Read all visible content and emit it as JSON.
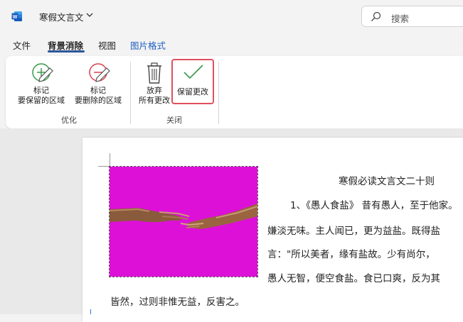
{
  "titlebar": {
    "doc_title": "寒假文言文",
    "search_placeholder": "搜索",
    "accent": "#2b579a"
  },
  "tabs": [
    {
      "label": "文件"
    },
    {
      "label": "背景消除",
      "active": true
    },
    {
      "label": "视图"
    },
    {
      "label": "图片格式"
    }
  ],
  "ribbon": {
    "mark_keep": {
      "line1": "标记",
      "line2": "要保留的区域",
      "icon": "plus-pencil-icon"
    },
    "mark_remove": {
      "line1": "标记",
      "line2": "要删除的区域",
      "icon": "minus-pencil-icon"
    },
    "group_refine": "优化",
    "discard": {
      "line1": "放弃",
      "line2": "所有更改",
      "icon": "trash-icon"
    },
    "keep_changes": {
      "label": "保留更改",
      "icon": "checkmark-icon"
    },
    "group_close": "关闭"
  },
  "document": {
    "title": "寒假必读文言文二十则",
    "lines": [
      "1、《愚人食盐》 昔有愚人，至于他家。",
      "嫌淡无味。主人闻已，更为益盐。既得盐",
      "言：\"所以美者，缘有盐故。少有尚尔，",
      "愚人无智，便空食盐。食已口爽，反为其",
      "皆然，过则非惟无益，反害之。"
    ],
    "image_bg_color": "#dd10d8"
  }
}
